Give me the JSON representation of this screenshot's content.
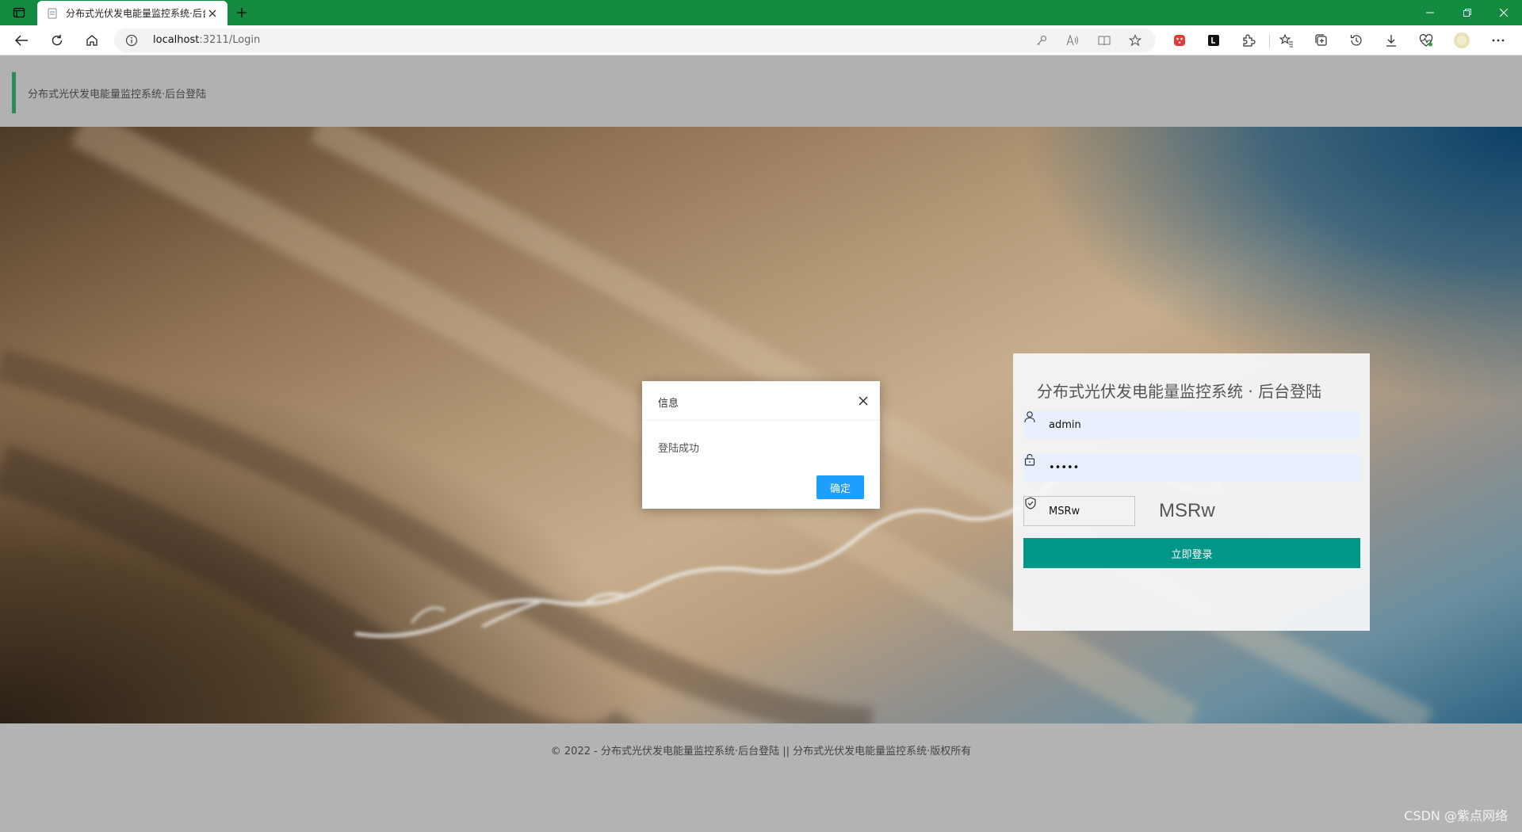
{
  "browser": {
    "tab_title": "分布式光伏发电能量监控系统·后台登陆",
    "url_host": "localhost",
    "url_rest": ":3211/Login"
  },
  "header": {
    "title": "分布式光伏发电能量监控系统·后台登陆"
  },
  "login": {
    "title": "分布式光伏发电能量监控系统 · 后台登陆",
    "username": "admin",
    "password": "•••••",
    "captcha_input": "MSRw",
    "captcha_code": "MSRw",
    "submit_label": "立即登录"
  },
  "dialog": {
    "title": "信息",
    "message": "登陆成功",
    "ok_label": "确定"
  },
  "footer": {
    "text": "© 2022 - 分布式光伏发电能量监控系统·后台登陆 || 分布式光伏发电能量监控系统·版权所有"
  },
  "watermark": "CSDN @紫点网络",
  "colors": {
    "browser_chrome": "#128a3f",
    "accent_bar": "#2e8b57",
    "login_button": "#009688",
    "dialog_button": "#1e9fff"
  }
}
